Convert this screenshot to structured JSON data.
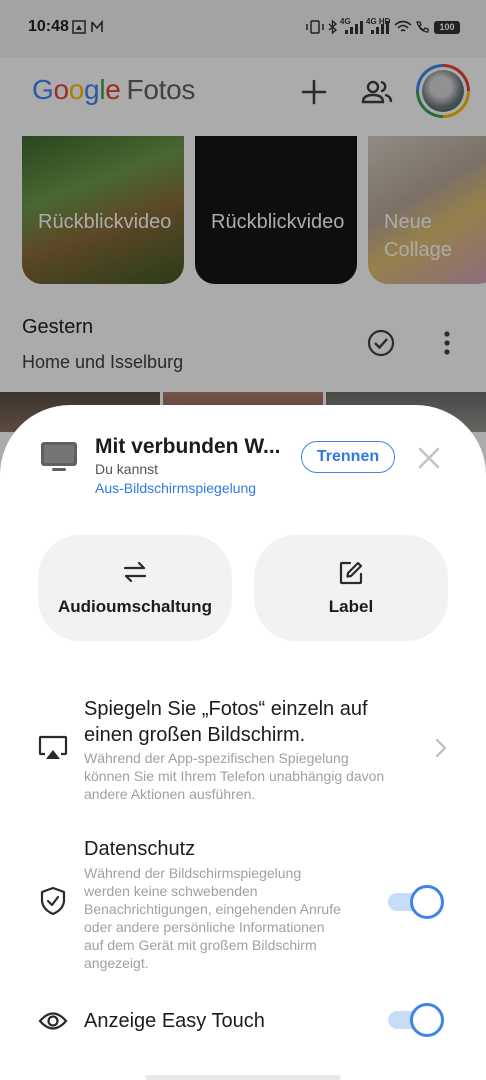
{
  "status_bar": {
    "time": "10:48",
    "battery": "100",
    "net_1": "4G",
    "net_2": "4G HD"
  },
  "app_bar": {
    "logo_google": [
      "G",
      "o",
      "o",
      "g",
      "l",
      "e"
    ],
    "logo_product": "Fotos",
    "add_icon": "plus-icon",
    "share_icon": "people-icon"
  },
  "memories": [
    {
      "label": "Rückblickvideo"
    },
    {
      "label": "Rückblickvideo"
    },
    {
      "label": "Neue Collage"
    }
  ],
  "section": {
    "title": "Gestern",
    "subtitle": "Home und Isselburg"
  },
  "cast_sheet": {
    "title": "Mit verbunden  W...",
    "subtitle": "Du kannst",
    "link": "Aus-Bildschirmspiegelung",
    "disconnect_label": "Trennen",
    "quick_actions": [
      {
        "icon": "swap-icon",
        "label": "Audioumschaltung"
      },
      {
        "icon": "edit-icon",
        "label": "Label"
      }
    ],
    "rows": [
      {
        "icon": "airplay-icon",
        "title": "Spiegeln Sie „Fotos“ einzeln auf einen großen Bildschirm.",
        "description": "Während der App-spezifischen Spiegelung können Sie mit Ihrem Telefon unabhängig davon andere Aktionen ausführen.",
        "control": "chevron"
      },
      {
        "icon": "shield-check-icon",
        "title": "Datenschutz",
        "description": "Während der Bildschirmspiegelung werden keine schwebenden Benachrichtigungen, eingehenden Anrufe oder andere persönliche Informationen auf dem Gerät mit großem Bildschirm angezeigt.",
        "control": "toggle",
        "enabled": true
      },
      {
        "icon": "eye-icon",
        "title": "Anzeige Easy Touch",
        "control": "toggle",
        "enabled": true
      }
    ]
  },
  "colors": {
    "accent": "#3d86e8",
    "toggle_track": "#c8dcf8",
    "muted_text": "#a0a0a0"
  }
}
